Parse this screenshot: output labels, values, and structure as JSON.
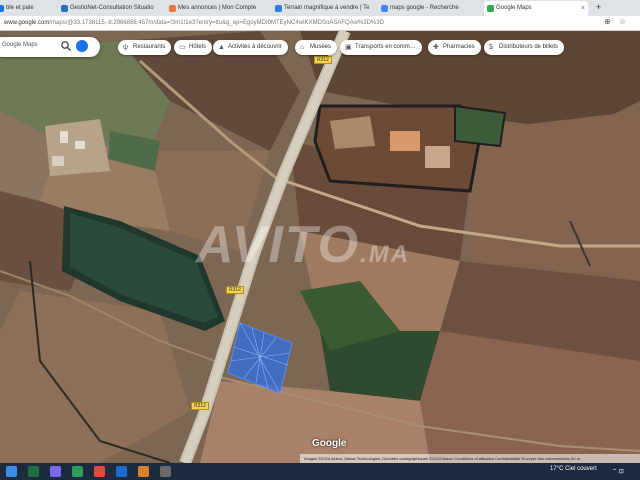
{
  "browser": {
    "tabs": [
      {
        "label": "ble et pale",
        "color": "#1b73e8"
      },
      {
        "label": "GestioNet-Consultation Situatio",
        "color": "#2a6fbd"
      },
      {
        "label": "Mes annonces | Mon Compte",
        "color": "#e8773d"
      },
      {
        "label": "Terrain magnifique à vendre | Te",
        "color": "#2e7de0"
      },
      {
        "label": "maps google - Recherche",
        "color": "#4285f4"
      },
      {
        "label": "Google Maps",
        "color": "#34a853"
      }
    ],
    "new_tab_label": "+",
    "window_controls": [
      "–",
      "□",
      "✕"
    ],
    "url_host": "www.google.com",
    "url_path": "/maps/@33.1738115,-8.2966886,457m/data=!3m1!1e3?entry=ttu&g_ep=EgoyMDI0MTEyNC4wIKXMDSoASAFQAw%3D%3D"
  },
  "map": {
    "search_placeholder": "Google Maps",
    "chips": [
      {
        "label": "Restaurants",
        "icon": "restaurant-icon"
      },
      {
        "label": "Hôtels",
        "icon": "hotel-icon"
      },
      {
        "label": "Activités à découvrir",
        "icon": "activities-icon"
      },
      {
        "label": "Musées",
        "icon": "museum-icon"
      },
      {
        "label": "Transports en comm…",
        "icon": "transit-icon"
      },
      {
        "label": "Pharmacies",
        "icon": "pharmacy-icon"
      },
      {
        "label": "Distributeurs de billets",
        "icon": "atm-icon"
      }
    ],
    "road_labels": [
      "R312",
      "R312",
      "R312"
    ],
    "watermark": "AVITO",
    "watermark_suffix": ".MA",
    "logo": "Google",
    "attribution": "Images ©2024 Airbus, Maxar Technologies, Données cartographiques ©2024   Maroc   Conditions d'utilisation   Confidentialité   Envoyer des commentaires   50 m"
  },
  "taskbar": {
    "weather": "17°C  Ciel couvert",
    "tray": "⌃ ⊡"
  }
}
